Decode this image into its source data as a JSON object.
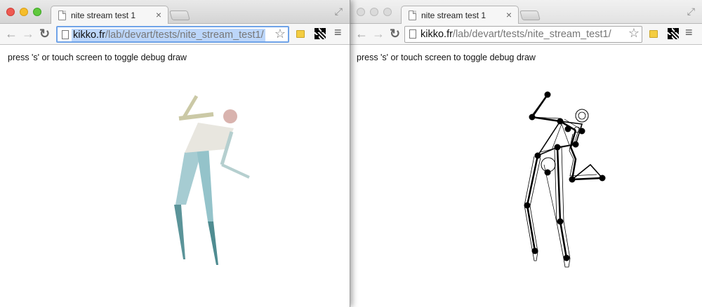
{
  "windows": [
    {
      "tab_title": "nite stream test 1",
      "url_host": "kikko.fr",
      "url_path": "/lab/devart/tests/nite_stream_test1/",
      "hint": "press 's' or touch screen to toggle debug draw"
    },
    {
      "tab_title": "nite stream test 1",
      "url_host": "kikko.fr",
      "url_path": "/lab/devart/tests/nite_stream_test1/",
      "hint": "press 's' or touch screen to toggle debug draw"
    }
  ],
  "icons": {
    "back": "back-arrow-icon",
    "forward": "forward-arrow-icon",
    "reload": "reload-icon",
    "bookmark": "star-icon",
    "menu": "hamburger-menu-icon"
  },
  "colors": {
    "body": "#e8e6df",
    "head": "#d9b3ae",
    "upper_arm": "#cbc9a6",
    "forearm": "#b5cfcf",
    "thigh": "#9cc8cf",
    "shin": "#4f8c91",
    "skeleton": "#000000"
  }
}
